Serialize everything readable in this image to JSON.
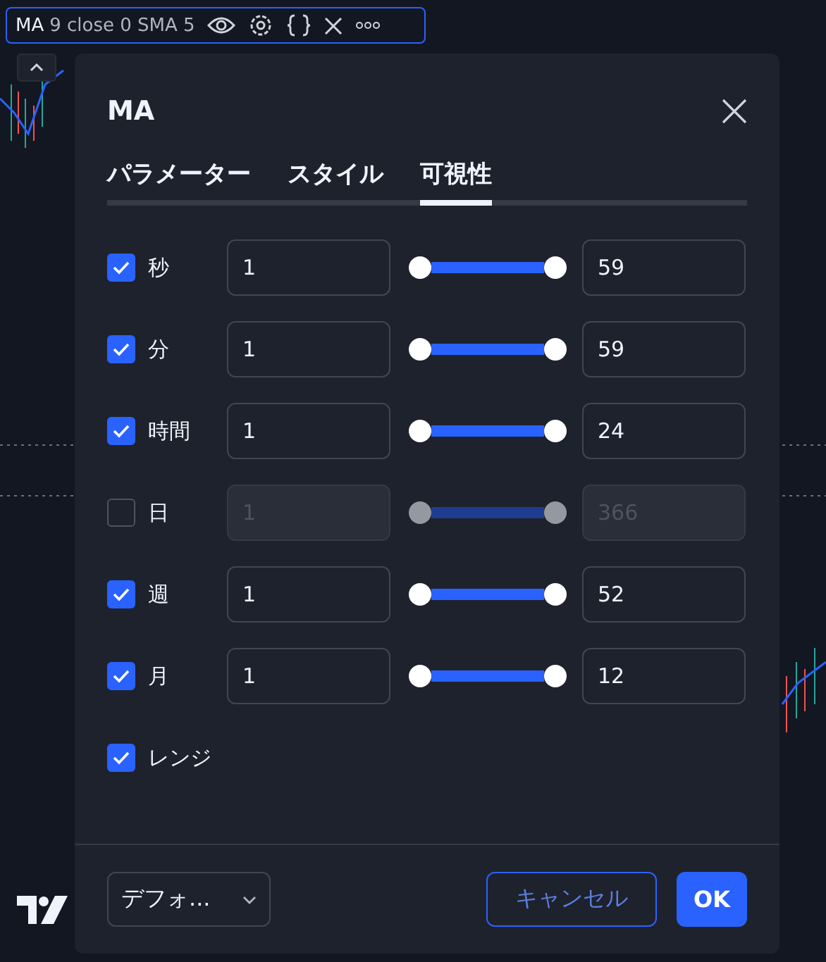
{
  "legend": {
    "name": "MA",
    "params": "9 close 0 SMA 5"
  },
  "dialog": {
    "title": "MA",
    "tabs": [
      {
        "label": "パラメーター",
        "selected": false
      },
      {
        "label": "スタイル",
        "selected": false
      },
      {
        "label": "可視性",
        "selected": true
      }
    ],
    "rows": [
      {
        "kind": "range",
        "label": "秒",
        "checked": true,
        "min": "1",
        "max": "59"
      },
      {
        "kind": "range",
        "label": "分",
        "checked": true,
        "min": "1",
        "max": "59"
      },
      {
        "kind": "range",
        "label": "時間",
        "checked": true,
        "min": "1",
        "max": "24"
      },
      {
        "kind": "range",
        "label": "日",
        "checked": false,
        "min": "1",
        "max": "366"
      },
      {
        "kind": "range",
        "label": "週",
        "checked": true,
        "min": "1",
        "max": "52"
      },
      {
        "kind": "range",
        "label": "月",
        "checked": true,
        "min": "1",
        "max": "12"
      },
      {
        "kind": "checkbox",
        "label": "レンジ",
        "checked": true
      }
    ],
    "template": "デフォ...",
    "buttons": [
      {
        "kind": "secondary",
        "label": "キャンセル"
      },
      {
        "kind": "primary",
        "label": "OK"
      }
    ]
  }
}
